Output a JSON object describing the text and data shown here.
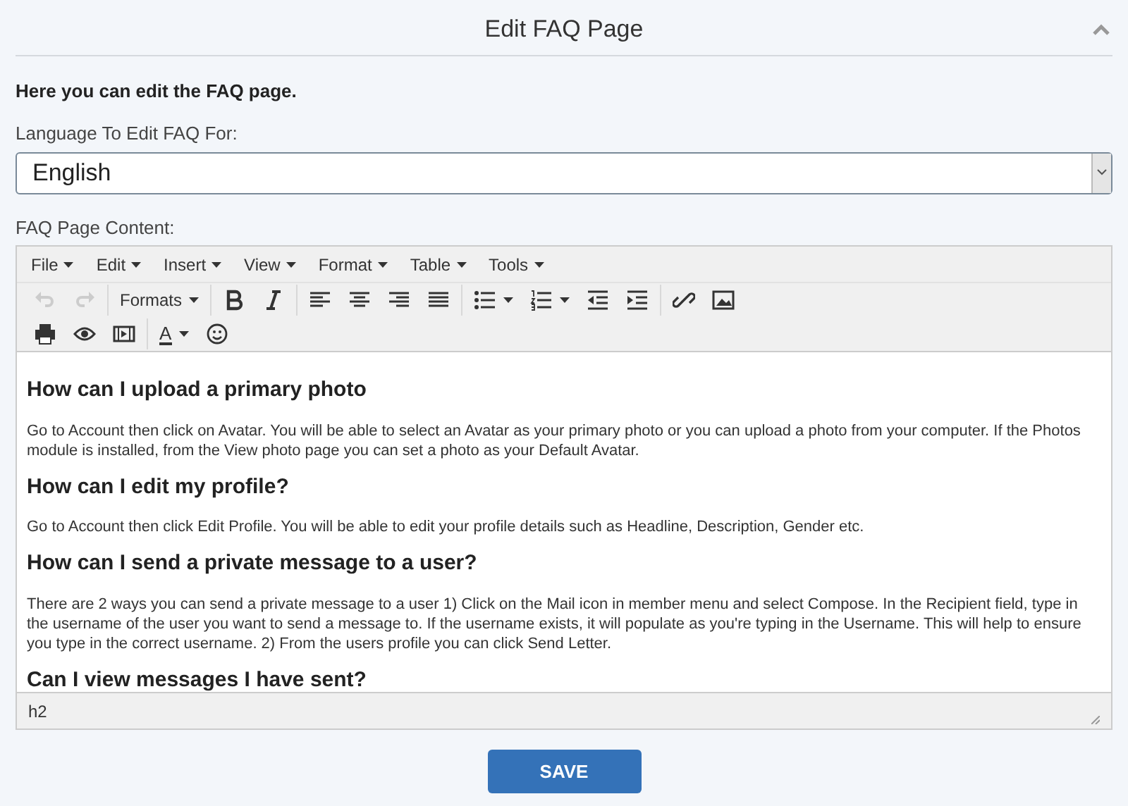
{
  "panel": {
    "title": "Edit FAQ Page",
    "collapsed": false
  },
  "intro": "Here you can edit the FAQ page.",
  "language": {
    "label": "Language To Edit FAQ For:",
    "value": "English"
  },
  "content_label": "FAQ Page Content:",
  "editor": {
    "menus": [
      "File",
      "Edit",
      "Insert",
      "View",
      "Format",
      "Table",
      "Tools"
    ],
    "toolbar": [
      [
        [
          {
            "kind": "icon",
            "disabled": true
          },
          {
            "kind": "icon",
            "disabled": true
          }
        ],
        [
          {
            "kind": "text_menu",
            "label": "Formats",
            "disabled": false
          }
        ],
        [
          {
            "kind": "icon",
            "disabled": false
          },
          {
            "kind": "icon",
            "disabled": false
          }
        ],
        [
          {
            "kind": "icon",
            "disabled": false
          },
          {
            "kind": "icon",
            "disabled": false
          },
          {
            "kind": "icon",
            "disabled": false
          },
          {
            "kind": "icon",
            "disabled": false
          }
        ],
        [
          {
            "kind": "icon_menu",
            "disabled": false
          },
          {
            "kind": "icon_menu",
            "disabled": false
          },
          {
            "kind": "icon",
            "disabled": false
          },
          {
            "kind": "icon",
            "disabled": false
          }
        ],
        [
          {
            "kind": "icon",
            "disabled": false
          },
          {
            "kind": "icon",
            "disabled": false
          }
        ]
      ],
      [
        [
          {
            "kind": "icon",
            "disabled": false
          },
          {
            "kind": "icon",
            "disabled": false
          },
          {
            "kind": "icon",
            "disabled": false
          }
        ],
        [
          {
            "kind": "text_menu",
            "label": "A",
            "disabled": false
          },
          {
            "kind": "icon",
            "disabled": false
          }
        ]
      ]
    ],
    "body": [
      {
        "kind": "heading",
        "text": "How can I upload a primary photo"
      },
      {
        "kind": "paragraph",
        "text": "Go to Account then click on Avatar. You will be able to select an Avatar as your primary photo or you can upload a photo from your computer. If the Photos module is installed, from the View photo page you can set a photo as your Default Avatar."
      },
      {
        "kind": "heading",
        "text": "How can I edit my profile?"
      },
      {
        "kind": "paragraph",
        "text": "Go to Account then click Edit Profile. You will be able to edit your profile details such as Headline, Description, Gender etc."
      },
      {
        "kind": "heading",
        "text": "How can I send a private message to a user?"
      },
      {
        "kind": "paragraph",
        "text": "There are 2 ways you can send a private message to a user 1) Click on the Mail icon in member menu and select Compose. In the Recipient field, type in the username of the user you want to send a message to. If the username exists, it will populate as you're typing in the Username. This will help to ensure you type in the correct username. 2) From the users profile you can click Send Letter."
      },
      {
        "kind": "heading",
        "text": "Can I view messages I have sent?"
      }
    ],
    "path": "h2"
  },
  "save_button": "SAVE"
}
